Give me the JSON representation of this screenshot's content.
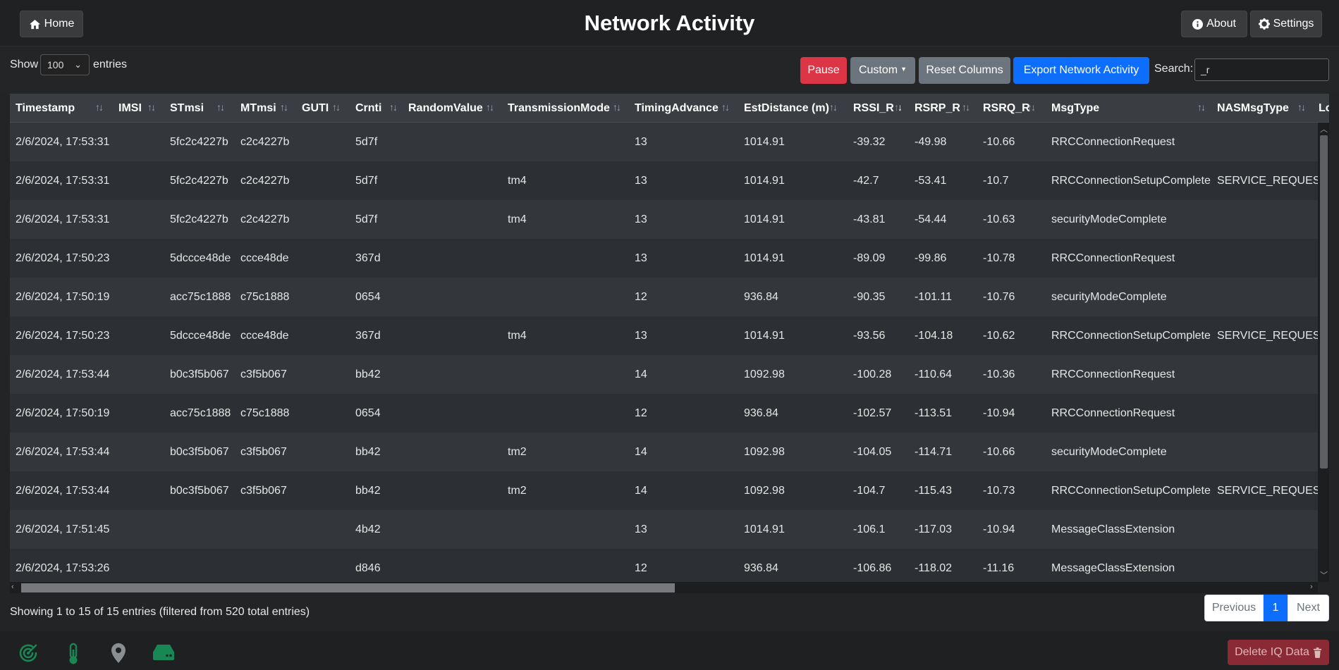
{
  "header": {
    "title": "Network Activity",
    "home_label": "Home",
    "about_label": "About",
    "settings_label": "Settings"
  },
  "controls": {
    "show_label": "Show",
    "page_length": "100",
    "entries_label": "entries",
    "pause_label": "Pause",
    "custom_label": "Custom",
    "reset_columns_label": "Reset Columns",
    "export_label": "Export Network Activity",
    "search_label": "Search:",
    "search_value": "_r"
  },
  "table": {
    "columns": [
      "Timestamp",
      "IMSI",
      "STmsi",
      "MTmsi",
      "GUTI",
      "Crnti",
      "RandomValue",
      "TransmissionMode",
      "TimingAdvance",
      "EstDistance (m)",
      "RSSI_R",
      "RSRP_R",
      "RSRQ_R",
      "MsgType",
      "NASMsgType",
      "Lo"
    ],
    "sorted_column": "RSSI_R",
    "rows": [
      [
        "2/6/2024, 17:53:31",
        "",
        "5fc2c4227b",
        "c2c4227b",
        "",
        "5d7f",
        "",
        "",
        "13",
        "1014.91",
        "-39.32",
        "-49.98",
        "-10.66",
        "RRCConnectionRequest",
        ""
      ],
      [
        "2/6/2024, 17:53:31",
        "",
        "5fc2c4227b",
        "c2c4227b",
        "",
        "5d7f",
        "",
        "tm4",
        "13",
        "1014.91",
        "-42.7",
        "-53.41",
        "-10.7",
        "RRCConnectionSetupComplete",
        "SERVICE_REQUEST"
      ],
      [
        "2/6/2024, 17:53:31",
        "",
        "5fc2c4227b",
        "c2c4227b",
        "",
        "5d7f",
        "",
        "tm4",
        "13",
        "1014.91",
        "-43.81",
        "-54.44",
        "-10.63",
        "securityModeComplete",
        ""
      ],
      [
        "2/6/2024, 17:50:23",
        "",
        "5dccce48de",
        "ccce48de",
        "",
        "367d",
        "",
        "",
        "13",
        "1014.91",
        "-89.09",
        "-99.86",
        "-10.78",
        "RRCConnectionRequest",
        ""
      ],
      [
        "2/6/2024, 17:50:19",
        "",
        "acc75c1888",
        "c75c1888",
        "",
        "0654",
        "",
        "",
        "12",
        "936.84",
        "-90.35",
        "-101.11",
        "-10.76",
        "securityModeComplete",
        ""
      ],
      [
        "2/6/2024, 17:50:23",
        "",
        "5dccce48de",
        "ccce48de",
        "",
        "367d",
        "",
        "tm4",
        "13",
        "1014.91",
        "-93.56",
        "-104.18",
        "-10.62",
        "RRCConnectionSetupComplete",
        "SERVICE_REQUEST"
      ],
      [
        "2/6/2024, 17:53:44",
        "",
        "b0c3f5b067",
        "c3f5b067",
        "",
        "bb42",
        "",
        "",
        "14",
        "1092.98",
        "-100.28",
        "-110.64",
        "-10.36",
        "RRCConnectionRequest",
        ""
      ],
      [
        "2/6/2024, 17:50:19",
        "",
        "acc75c1888",
        "c75c1888",
        "",
        "0654",
        "",
        "",
        "12",
        "936.84",
        "-102.57",
        "-113.51",
        "-10.94",
        "RRCConnectionRequest",
        ""
      ],
      [
        "2/6/2024, 17:53:44",
        "",
        "b0c3f5b067",
        "c3f5b067",
        "",
        "bb42",
        "",
        "tm2",
        "14",
        "1092.98",
        "-104.05",
        "-114.71",
        "-10.66",
        "securityModeComplete",
        ""
      ],
      [
        "2/6/2024, 17:53:44",
        "",
        "b0c3f5b067",
        "c3f5b067",
        "",
        "bb42",
        "",
        "tm2",
        "14",
        "1092.98",
        "-104.7",
        "-115.43",
        "-10.73",
        "RRCConnectionSetupComplete",
        "SERVICE_REQUEST"
      ],
      [
        "2/6/2024, 17:51:45",
        "",
        "",
        "",
        "",
        "4b42",
        "",
        "",
        "13",
        "1014.91",
        "-106.1",
        "-117.03",
        "-10.94",
        "MessageClassExtension",
        ""
      ],
      [
        "2/6/2024, 17:53:26",
        "",
        "",
        "",
        "",
        "d846",
        "",
        "",
        "12",
        "936.84",
        "-106.86",
        "-118.02",
        "-11.16",
        "MessageClassExtension",
        ""
      ]
    ]
  },
  "pagination": {
    "info": "Showing 1 to 15 of 15 entries (filtered from 520 total entries)",
    "previous_label": "Previous",
    "current_page": "1",
    "next_label": "Next"
  },
  "footer": {
    "icons": [
      "radar-icon",
      "thermometer-icon",
      "map-marker-icon",
      "hard-drive-icon"
    ],
    "delete_label": "Delete IQ Data"
  },
  "colors": {
    "pause": "#dc3545",
    "custom": "#6c757d",
    "primary": "#0d6efd",
    "footer_icons": "#198754",
    "delete": "#8a2a34"
  }
}
